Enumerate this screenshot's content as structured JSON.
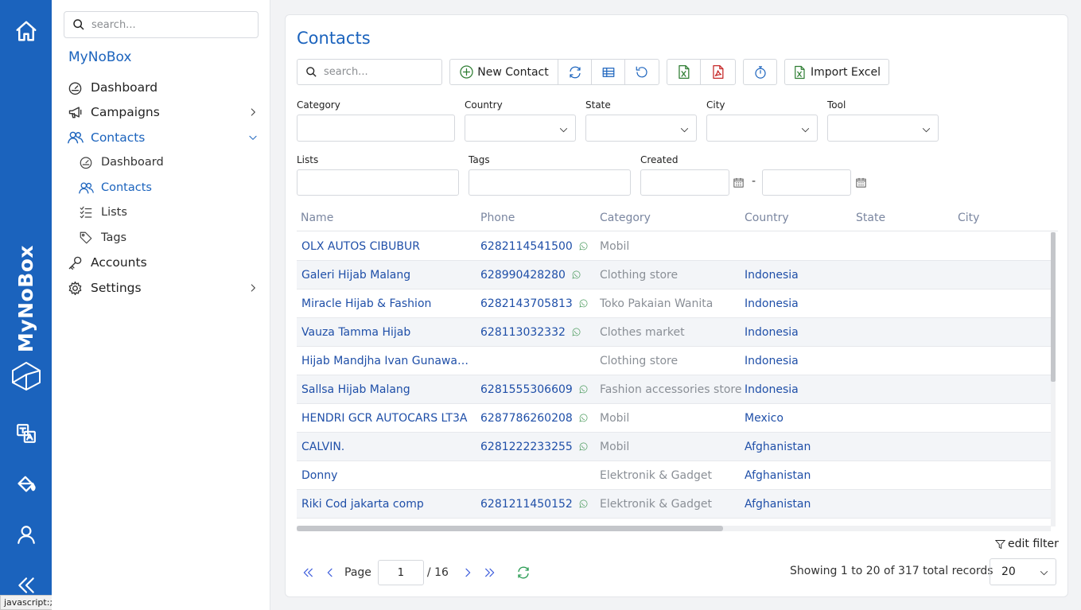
{
  "rail": {
    "brand": "MyNoBox",
    "icons": [
      "home-icon",
      "logo-cube-icon",
      "translate-icon",
      "paint-bucket-icon",
      "user-icon",
      "collapse-icon"
    ],
    "status_text": "javascript:;"
  },
  "sidebar": {
    "search_placeholder": "search...",
    "brand": "MyNoBox",
    "items": [
      {
        "label": "Dashboard",
        "icon": "gauge-icon"
      },
      {
        "label": "Campaigns",
        "icon": "megaphone-icon"
      },
      {
        "label": "Contacts",
        "icon": "users-icon",
        "active": true
      },
      {
        "label": "Accounts",
        "icon": "key-icon"
      },
      {
        "label": "Settings",
        "icon": "gear-icon"
      }
    ],
    "sub_items": [
      {
        "label": "Dashboard",
        "icon": "gauge-icon"
      },
      {
        "label": "Contacts",
        "icon": "users-icon",
        "active": true
      },
      {
        "label": "Lists",
        "icon": "list-icon"
      },
      {
        "label": "Tags",
        "icon": "tag-icon"
      }
    ]
  },
  "main": {
    "title": "Contacts",
    "search_placeholder": "search...",
    "new_contact_label": "New Contact",
    "import_excel_label": "Import Excel",
    "filters": {
      "category": "Category",
      "country": "Country",
      "state": "State",
      "city": "City",
      "tool": "Tool",
      "lists": "Lists",
      "tags": "Tags",
      "created": "Created",
      "range_dash": "-"
    },
    "columns": [
      "Name",
      "Phone",
      "Category",
      "Country",
      "State",
      "City"
    ],
    "rows": [
      {
        "name": "OLX AUTOS CIBUBUR",
        "phone": "6282114541500",
        "category": "Mobil",
        "country": ""
      },
      {
        "name": "Galeri Hijab Malang",
        "phone": "628990428280",
        "category": "Clothing store",
        "country": "Indonesia"
      },
      {
        "name": "Miracle Hijab & Fashion",
        "phone": "6282143705813",
        "category": "Toko Pakaian Wanita",
        "country": "Indonesia"
      },
      {
        "name": "Vauza Tamma Hijab",
        "phone": "628113032332",
        "category": "Clothes market",
        "country": "Indonesia"
      },
      {
        "name": "Hijab Mandjha Ivan Gunawan …",
        "phone": "",
        "category": "Clothing store",
        "country": "Indonesia"
      },
      {
        "name": "Sallsa Hijab Malang",
        "phone": "6281555306609",
        "category": "Fashion accessories store",
        "country": "Indonesia"
      },
      {
        "name": "HENDRI GCR AUTOCARS LT3A",
        "phone": "6287786260208",
        "category": "Mobil",
        "country": "Mexico"
      },
      {
        "name": "CALVIN.",
        "phone": "6281222233255",
        "category": "Mobil",
        "country": "Afghanistan"
      },
      {
        "name": "Donny",
        "phone": "",
        "category": "Elektronik & Gadget",
        "country": "Afghanistan"
      },
      {
        "name": "Riki Cod jakarta comp",
        "phone": "6281211450152",
        "category": "Elektronik & Gadget",
        "country": "Afghanistan"
      },
      {
        "name": "",
        "phone": "",
        "category": "",
        "country": ""
      }
    ],
    "edit_filter_label": "edit filter",
    "pager": {
      "page_label": "Page",
      "page_value": "1",
      "total_pages": "/ 16",
      "records_text": "Showing 1 to 20 of 317 total records",
      "page_size": "20"
    }
  },
  "colors": {
    "rail": "#1b63bd",
    "accent": "#1b63bd",
    "link": "#1f4fa8",
    "excel": "#2e7d32",
    "pdf": "#c62828"
  }
}
